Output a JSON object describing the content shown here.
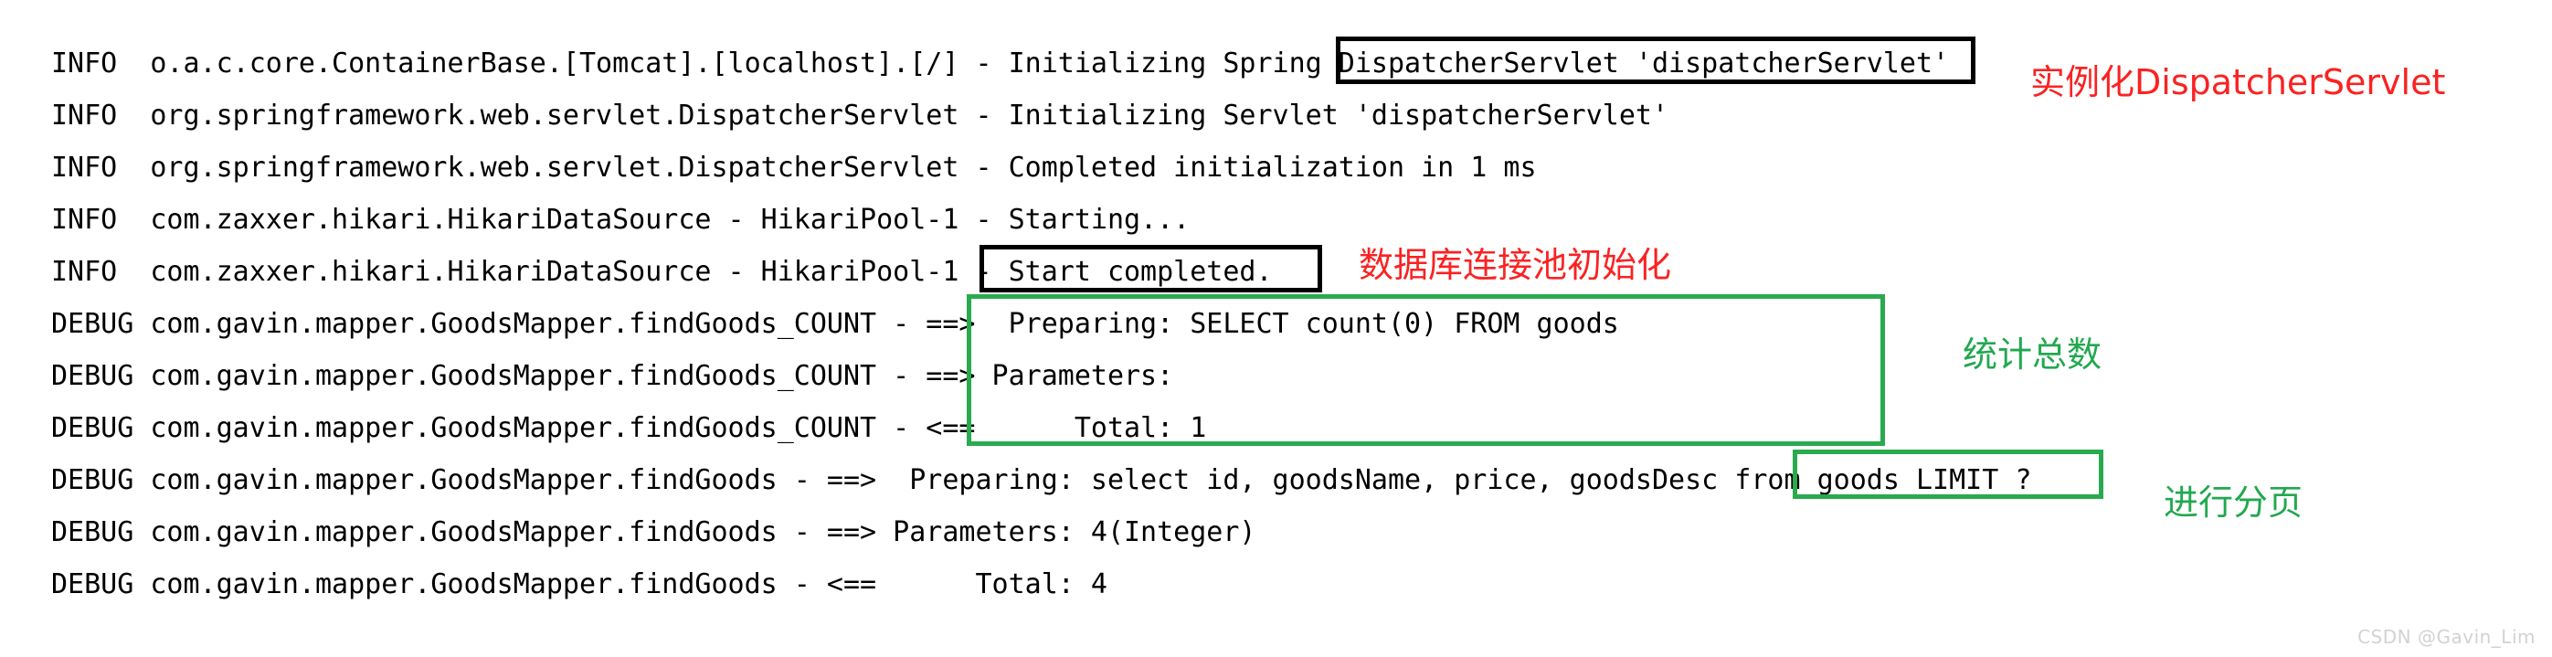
{
  "console": {
    "background_color": "#ffffff",
    "text_color": "#000000",
    "lines": [
      "INFO  o.a.c.core.ContainerBase.[Tomcat].[localhost].[/] - Initializing Spring DispatcherServlet 'dispatcherServlet'",
      "INFO  org.springframework.web.servlet.DispatcherServlet - Initializing Servlet 'dispatcherServlet'",
      "INFO  org.springframework.web.servlet.DispatcherServlet - Completed initialization in 1 ms",
      "INFO  com.zaxxer.hikari.HikariDataSource - HikariPool-1 - Starting...",
      "INFO  com.zaxxer.hikari.HikariDataSource - HikariPool-1 - Start completed.",
      "DEBUG com.gavin.mapper.GoodsMapper.findGoods_COUNT - ==>  Preparing: SELECT count(0) FROM goods",
      "DEBUG com.gavin.mapper.GoodsMapper.findGoods_COUNT - ==> Parameters:",
      "DEBUG com.gavin.mapper.GoodsMapper.findGoods_COUNT - <==      Total: 1",
      "DEBUG com.gavin.mapper.GoodsMapper.findGoods - ==>  Preparing: select id, goodsName, price, goodsDesc from goods LIMIT ?",
      "DEBUG com.gavin.mapper.GoodsMapper.findGoods - ==> Parameters: 4(Integer)",
      "DEBUG com.gavin.mapper.GoodsMapper.findGoods - <==      Total: 4"
    ]
  },
  "highlights": [
    {
      "id": "box-dispatcher",
      "color": "#000000",
      "text": "DispatcherServlet 'dispatcherServlet'"
    },
    {
      "id": "box-startcompleted",
      "color": "#000000",
      "text": "Start completed."
    },
    {
      "id": "box-count",
      "color": "#2aaa4f",
      "text": "Preparing: SELECT count(0) FROM goods / Parameters: / Total: 1"
    },
    {
      "id": "box-limit",
      "color": "#2aaa4f",
      "text": "goods LIMIT ?"
    }
  ],
  "annotations": {
    "dispatcher": {
      "text": "实例化DispatcherServlet",
      "color": "#fa2222"
    },
    "datasource": {
      "text": "数据库连接池初始化",
      "color": "#fa2222"
    },
    "count": {
      "text": "统计总数",
      "color": "#22a84f"
    },
    "paging": {
      "text": "进行分页",
      "color": "#22a84f"
    }
  },
  "watermark": {
    "text": "CSDN @Gavin_Lim",
    "color": "#d2d2d2"
  }
}
